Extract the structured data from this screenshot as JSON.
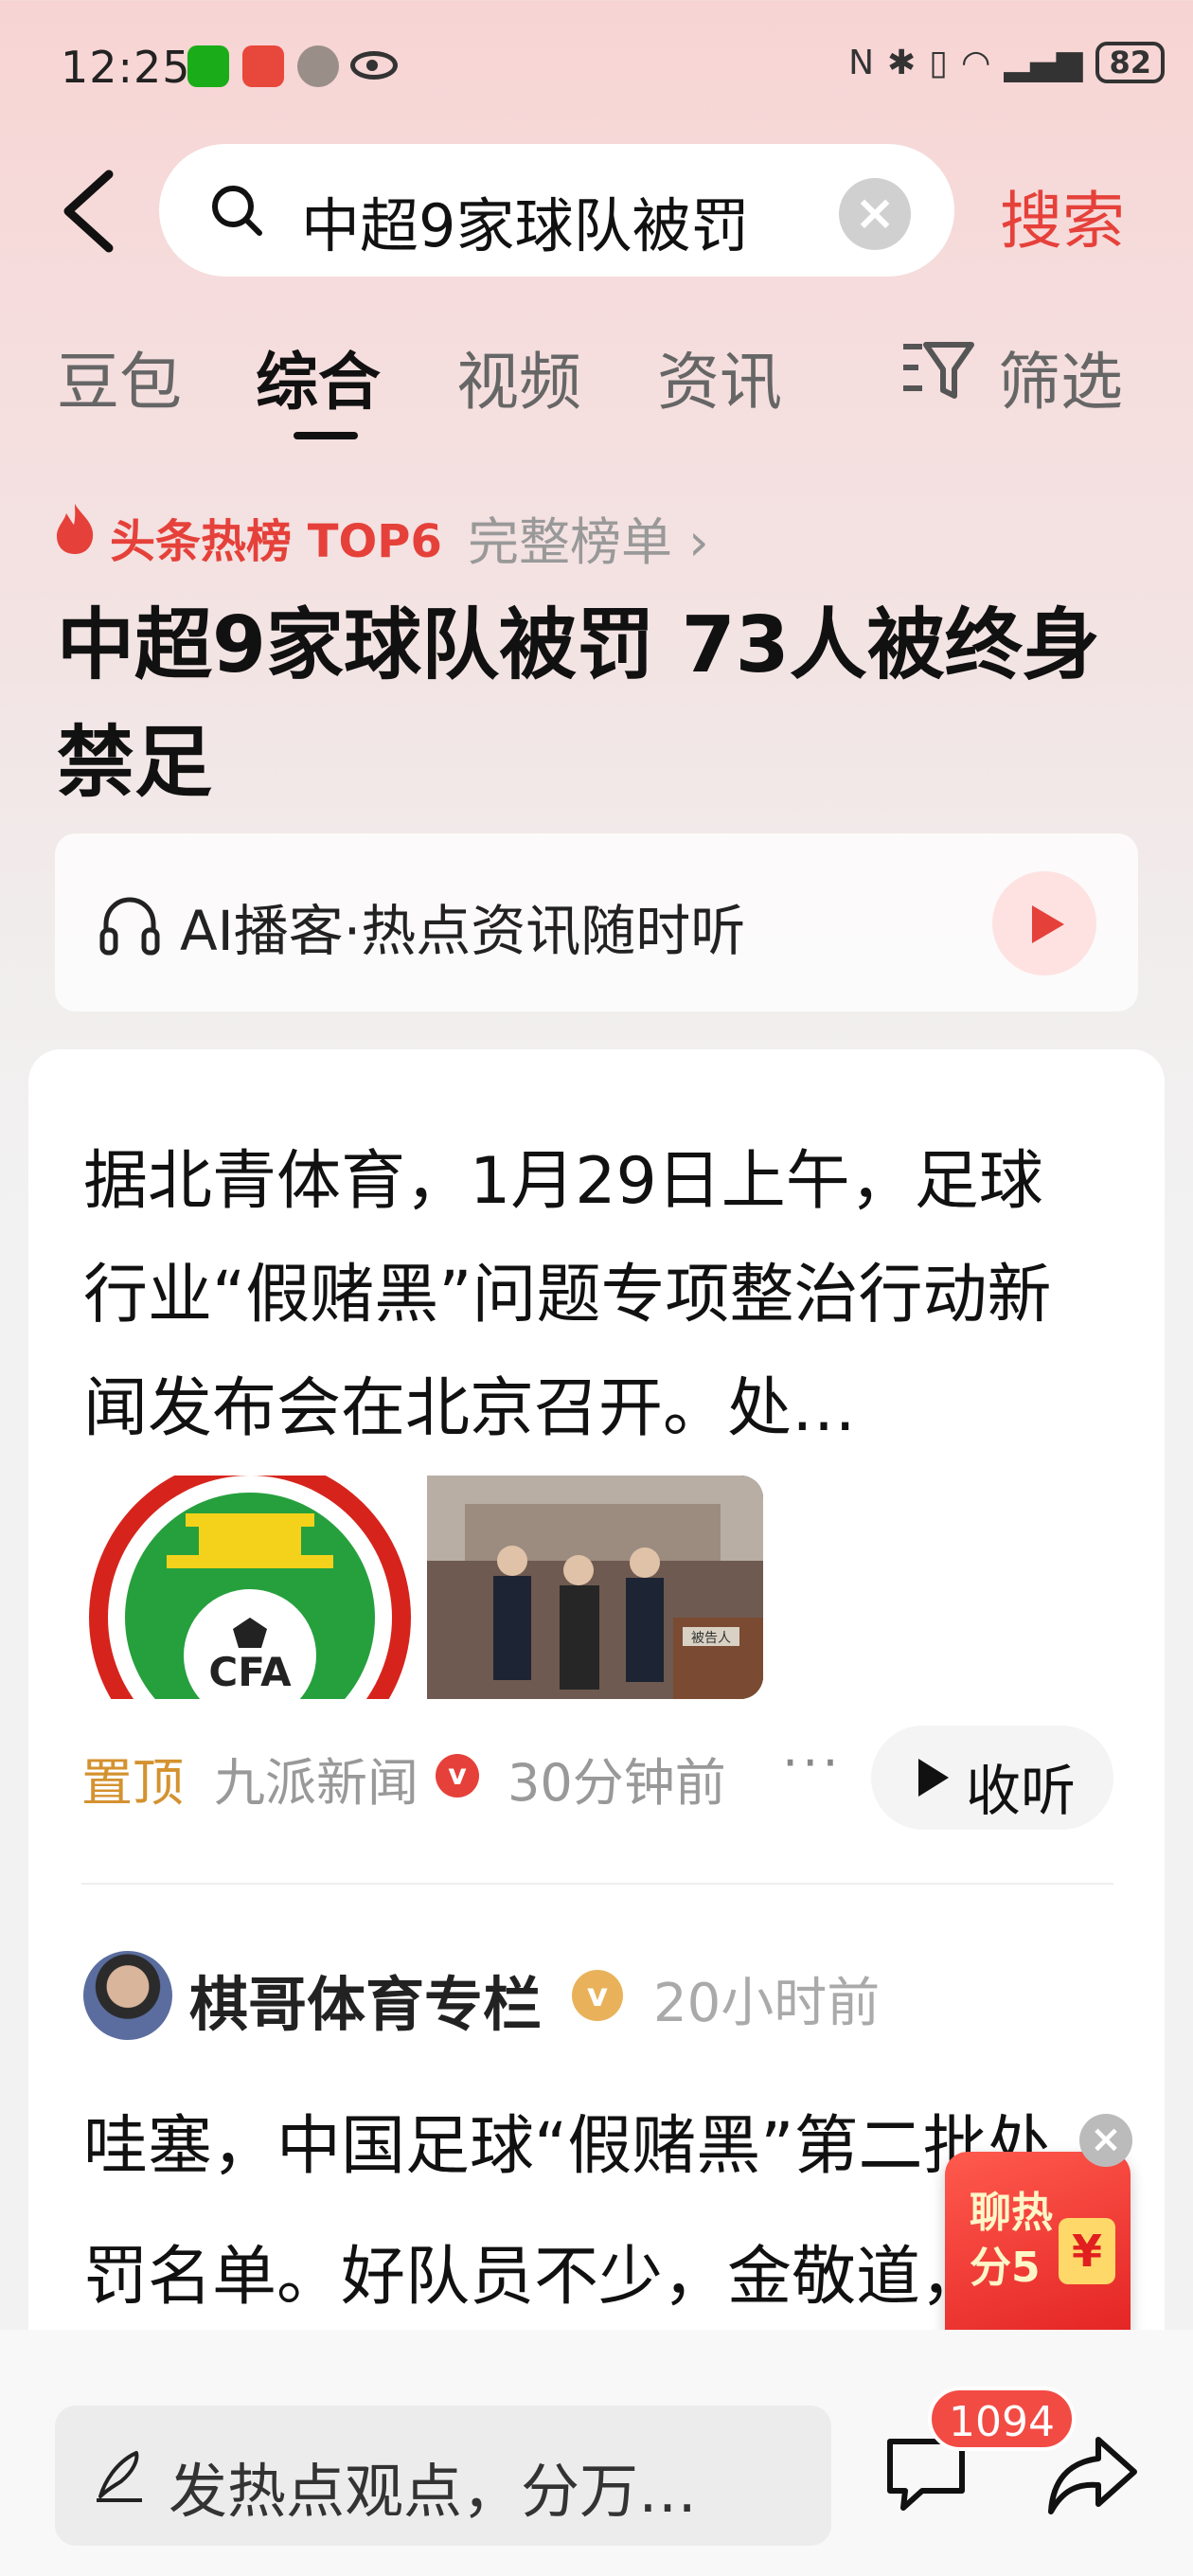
{
  "status_bar": {
    "time": "12:25",
    "battery": "82"
  },
  "search": {
    "query": "中超9家球队被罚",
    "search_label": "搜索"
  },
  "tabs": [
    {
      "label": "豆包"
    },
    {
      "label": "综合"
    },
    {
      "label": "视频"
    },
    {
      "label": "资讯"
    }
  ],
  "active_tab": "综合",
  "filter_label": "筛选",
  "hot": {
    "label": "头条热榜 TOP6",
    "full_list": "完整榜单 ›"
  },
  "headline": "中超9家球队被罚 73人被终身禁足",
  "podcast": {
    "text": "AI播客·热点资讯随时听"
  },
  "article": {
    "summary": "据北青体育，1月29日上午，足球行业“假赌黑”问题专项整治行动新闻发布会在北京召开。处…",
    "pinned": "置顶",
    "source": "九派新闻",
    "verified_mark": "v",
    "time": "30分钟前",
    "more": "···",
    "listen_label": "收听",
    "image1_text": "CFA",
    "image2_caption": "被告人"
  },
  "post": {
    "author": "棋哥体育专栏",
    "verified_mark": "v",
    "time": "20小时前",
    "text": "哇塞，中国足球“假赌黑”第二批处罚名单。好队员不少，金敬道，郭田雨，顾超，杨善平"
  },
  "float_ad": {
    "label": "聊热分5",
    "yuan": "¥",
    "close": "×"
  },
  "bottom": {
    "comment_placeholder": "发热点观点，分万…",
    "comment_count": "1094"
  }
}
